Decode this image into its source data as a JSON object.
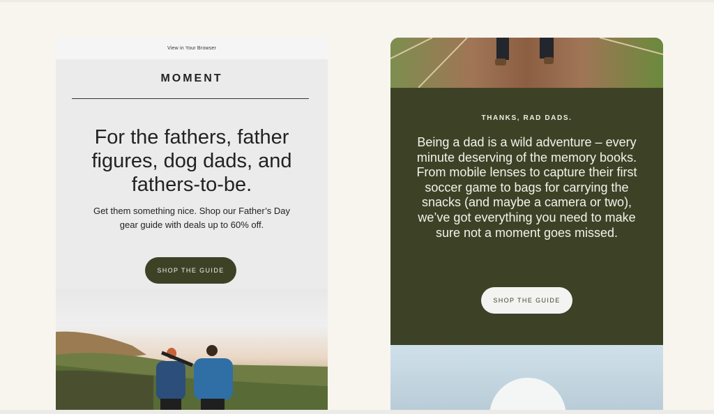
{
  "left_email": {
    "view_in_browser": "View in Your Browser",
    "logo": "MOMENT",
    "headline": "For the fathers, father figures, dog dads, and fathers-to-be.",
    "subtext": "Get them something nice. Shop our Father’s Day gear guide with deals up to 60% off.",
    "cta": "SHOP THE GUIDE"
  },
  "right_email": {
    "eyebrow": "THANKS, RAD DADS.",
    "body": "Being a dad is a wild adventure – every minute deserving of the memory books. From mobile lenses to capture their first soccer game to bags for carrying the snacks (and maybe a camera or two), we’ve got everything you need to make sure not a moment goes missed.",
    "cta": "SHOP THE GUIDE"
  },
  "colors": {
    "accent_dark_green": "#3d4227",
    "page_background": "#f8f5ef"
  }
}
